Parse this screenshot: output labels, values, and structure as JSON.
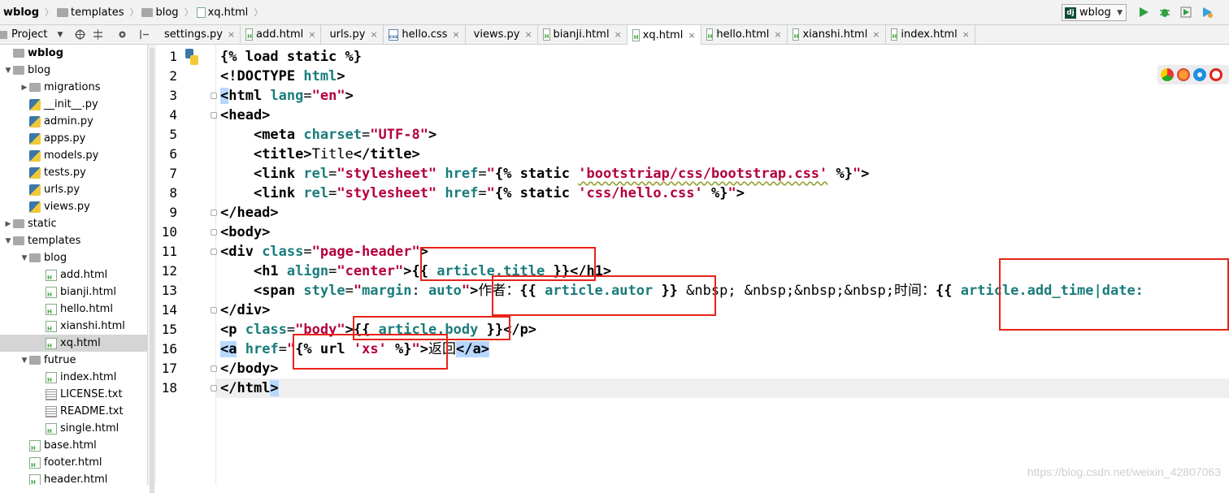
{
  "breadcrumb": [
    "wblog",
    "templates",
    "blog",
    "xq.html"
  ],
  "run_config": "wblog",
  "project_panel": {
    "title": "Project"
  },
  "tabs": [
    {
      "label": "settings.py",
      "type": "py"
    },
    {
      "label": "add.html",
      "type": "html"
    },
    {
      "label": "urls.py",
      "type": "py"
    },
    {
      "label": "hello.css",
      "type": "css"
    },
    {
      "label": "views.py",
      "type": "py"
    },
    {
      "label": "bianji.html",
      "type": "html"
    },
    {
      "label": "xq.html",
      "type": "html",
      "active": true
    },
    {
      "label": "hello.html",
      "type": "html"
    },
    {
      "label": "xianshi.html",
      "type": "html"
    },
    {
      "label": "index.html",
      "type": "html"
    }
  ],
  "tree": [
    {
      "label": "wblog",
      "depth": 0,
      "kind": "root"
    },
    {
      "label": "blog",
      "depth": 0,
      "kind": "folder",
      "open": true
    },
    {
      "label": "migrations",
      "depth": 1,
      "kind": "folder",
      "open": false
    },
    {
      "label": "__init__.py",
      "depth": 1,
      "kind": "py"
    },
    {
      "label": "admin.py",
      "depth": 1,
      "kind": "py"
    },
    {
      "label": "apps.py",
      "depth": 1,
      "kind": "py"
    },
    {
      "label": "models.py",
      "depth": 1,
      "kind": "py"
    },
    {
      "label": "tests.py",
      "depth": 1,
      "kind": "py"
    },
    {
      "label": "urls.py",
      "depth": 1,
      "kind": "py"
    },
    {
      "label": "views.py",
      "depth": 1,
      "kind": "py"
    },
    {
      "label": "static",
      "depth": 0,
      "kind": "folder",
      "open": false
    },
    {
      "label": "templates",
      "depth": 0,
      "kind": "folder",
      "open": true
    },
    {
      "label": "blog",
      "depth": 1,
      "kind": "folder",
      "open": true
    },
    {
      "label": "add.html",
      "depth": 2,
      "kind": "html"
    },
    {
      "label": "bianji.html",
      "depth": 2,
      "kind": "html"
    },
    {
      "label": "hello.html",
      "depth": 2,
      "kind": "html"
    },
    {
      "label": "xianshi.html",
      "depth": 2,
      "kind": "html"
    },
    {
      "label": "xq.html",
      "depth": 2,
      "kind": "html",
      "selected": true
    },
    {
      "label": "futrue",
      "depth": 1,
      "kind": "folder",
      "open": true
    },
    {
      "label": "index.html",
      "depth": 2,
      "kind": "html"
    },
    {
      "label": "LICENSE.txt",
      "depth": 2,
      "kind": "txt"
    },
    {
      "label": "README.txt",
      "depth": 2,
      "kind": "txt"
    },
    {
      "label": "single.html",
      "depth": 2,
      "kind": "html"
    },
    {
      "label": "base.html",
      "depth": 1,
      "kind": "html"
    },
    {
      "label": "footer.html",
      "depth": 1,
      "kind": "html"
    },
    {
      "label": "header.html",
      "depth": 1,
      "kind": "html"
    }
  ],
  "code_lines": [
    [
      [
        "kw",
        "{% load static %}"
      ]
    ],
    [
      [
        "tag",
        "<!DOCTYPE "
      ],
      [
        "attr",
        "html"
      ],
      [
        "tag",
        ">"
      ]
    ],
    [
      [
        "taghl",
        "<"
      ],
      [
        "tag",
        "html "
      ],
      [
        "attr",
        "lang"
      ],
      [
        "text",
        "="
      ],
      [
        "str",
        "\"en\""
      ],
      [
        "tag",
        ">"
      ]
    ],
    [
      [
        "tag",
        "<head>"
      ]
    ],
    [
      [
        "text",
        "    "
      ],
      [
        "tag",
        "<meta "
      ],
      [
        "attr",
        "charset"
      ],
      [
        "text",
        "="
      ],
      [
        "str",
        "\"UTF-8\""
      ],
      [
        "tag",
        ">"
      ]
    ],
    [
      [
        "text",
        "    "
      ],
      [
        "tag",
        "<title>"
      ],
      [
        "text",
        "Title"
      ],
      [
        "tag",
        "</title>"
      ]
    ],
    [
      [
        "text",
        "    "
      ],
      [
        "tag",
        "<link "
      ],
      [
        "attr",
        "rel"
      ],
      [
        "text",
        "="
      ],
      [
        "str",
        "\"stylesheet\""
      ],
      [
        "text",
        " "
      ],
      [
        "attr",
        "href"
      ],
      [
        "text",
        "="
      ],
      [
        "str",
        "\""
      ],
      [
        "kw",
        "{% static "
      ],
      [
        "sq",
        "'bootstriap/css/bootstrap.css'"
      ],
      [
        "kw",
        " %}"
      ],
      [
        "str",
        "\""
      ],
      [
        "tag",
        ">"
      ]
    ],
    [
      [
        "text",
        "    "
      ],
      [
        "tag",
        "<link "
      ],
      [
        "attr",
        "rel"
      ],
      [
        "text",
        "="
      ],
      [
        "str",
        "\"stylesheet\""
      ],
      [
        "text",
        " "
      ],
      [
        "attr",
        "href"
      ],
      [
        "text",
        "="
      ],
      [
        "str",
        "\""
      ],
      [
        "kw",
        "{% static "
      ],
      [
        "sq",
        "'css/hello.css'"
      ],
      [
        "kw",
        " %}"
      ],
      [
        "str",
        "\""
      ],
      [
        "tag",
        ">"
      ]
    ],
    [
      [
        "tag",
        "</head>"
      ]
    ],
    [
      [
        "tag",
        "<body>"
      ]
    ],
    [
      [
        "tag",
        "<div "
      ],
      [
        "attr",
        "class"
      ],
      [
        "text",
        "="
      ],
      [
        "str",
        "\"page-header\""
      ],
      [
        "tag",
        ">"
      ]
    ],
    [
      [
        "text",
        "    "
      ],
      [
        "tag",
        "<h1 "
      ],
      [
        "attr",
        "align"
      ],
      [
        "text",
        "="
      ],
      [
        "str",
        "\"center\""
      ],
      [
        "tag",
        ">"
      ],
      [
        "kw",
        "{{ "
      ],
      [
        "var",
        "article.title"
      ],
      [
        "kw",
        " }}"
      ],
      [
        "tag",
        "</h1>"
      ]
    ],
    [
      [
        "text",
        "    "
      ],
      [
        "tag",
        "<span "
      ],
      [
        "attr",
        "style"
      ],
      [
        "text",
        "="
      ],
      [
        "str",
        "\""
      ],
      [
        "var",
        "margin"
      ],
      [
        "text",
        ": "
      ],
      [
        "var",
        "auto"
      ],
      [
        "str",
        "\""
      ],
      [
        "tag",
        ">"
      ],
      [
        "text",
        "作者："
      ],
      [
        "kw",
        "{{ "
      ],
      [
        "var",
        "article.autor"
      ],
      [
        "kw",
        " }}"
      ],
      [
        "text",
        " &nbsp; &nbsp;&nbsp;&nbsp;时间："
      ],
      [
        "kw",
        "{{ "
      ],
      [
        "var",
        "article.add_time|date:"
      ]
    ],
    [
      [
        "tag",
        "</div>"
      ]
    ],
    [
      [
        "tag",
        "<p "
      ],
      [
        "attr",
        "class"
      ],
      [
        "text",
        "="
      ],
      [
        "str",
        "\"body\""
      ],
      [
        "tag",
        ">"
      ],
      [
        "kw",
        "{{ "
      ],
      [
        "var",
        "article.body"
      ],
      [
        "kw",
        " }}"
      ],
      [
        "tag",
        "</p>"
      ]
    ],
    [
      [
        "taghl",
        "<a"
      ],
      [
        "text",
        " "
      ],
      [
        "attr",
        "href"
      ],
      [
        "text",
        "="
      ],
      [
        "str",
        "\""
      ],
      [
        "kw",
        "{% url "
      ],
      [
        "sq",
        "'xs'"
      ],
      [
        "kw",
        " %}"
      ],
      [
        "str",
        "\""
      ],
      [
        "tag",
        ">"
      ],
      [
        "text",
        "返回"
      ],
      [
        "taghl",
        "</a>"
      ]
    ],
    [
      [
        "tag",
        "</body>"
      ]
    ],
    [
      [
        "tag",
        "</html"
      ],
      [
        "taghl",
        ">"
      ]
    ]
  ],
  "watermark": "https://blog.csdn.net/weixin_42807063"
}
